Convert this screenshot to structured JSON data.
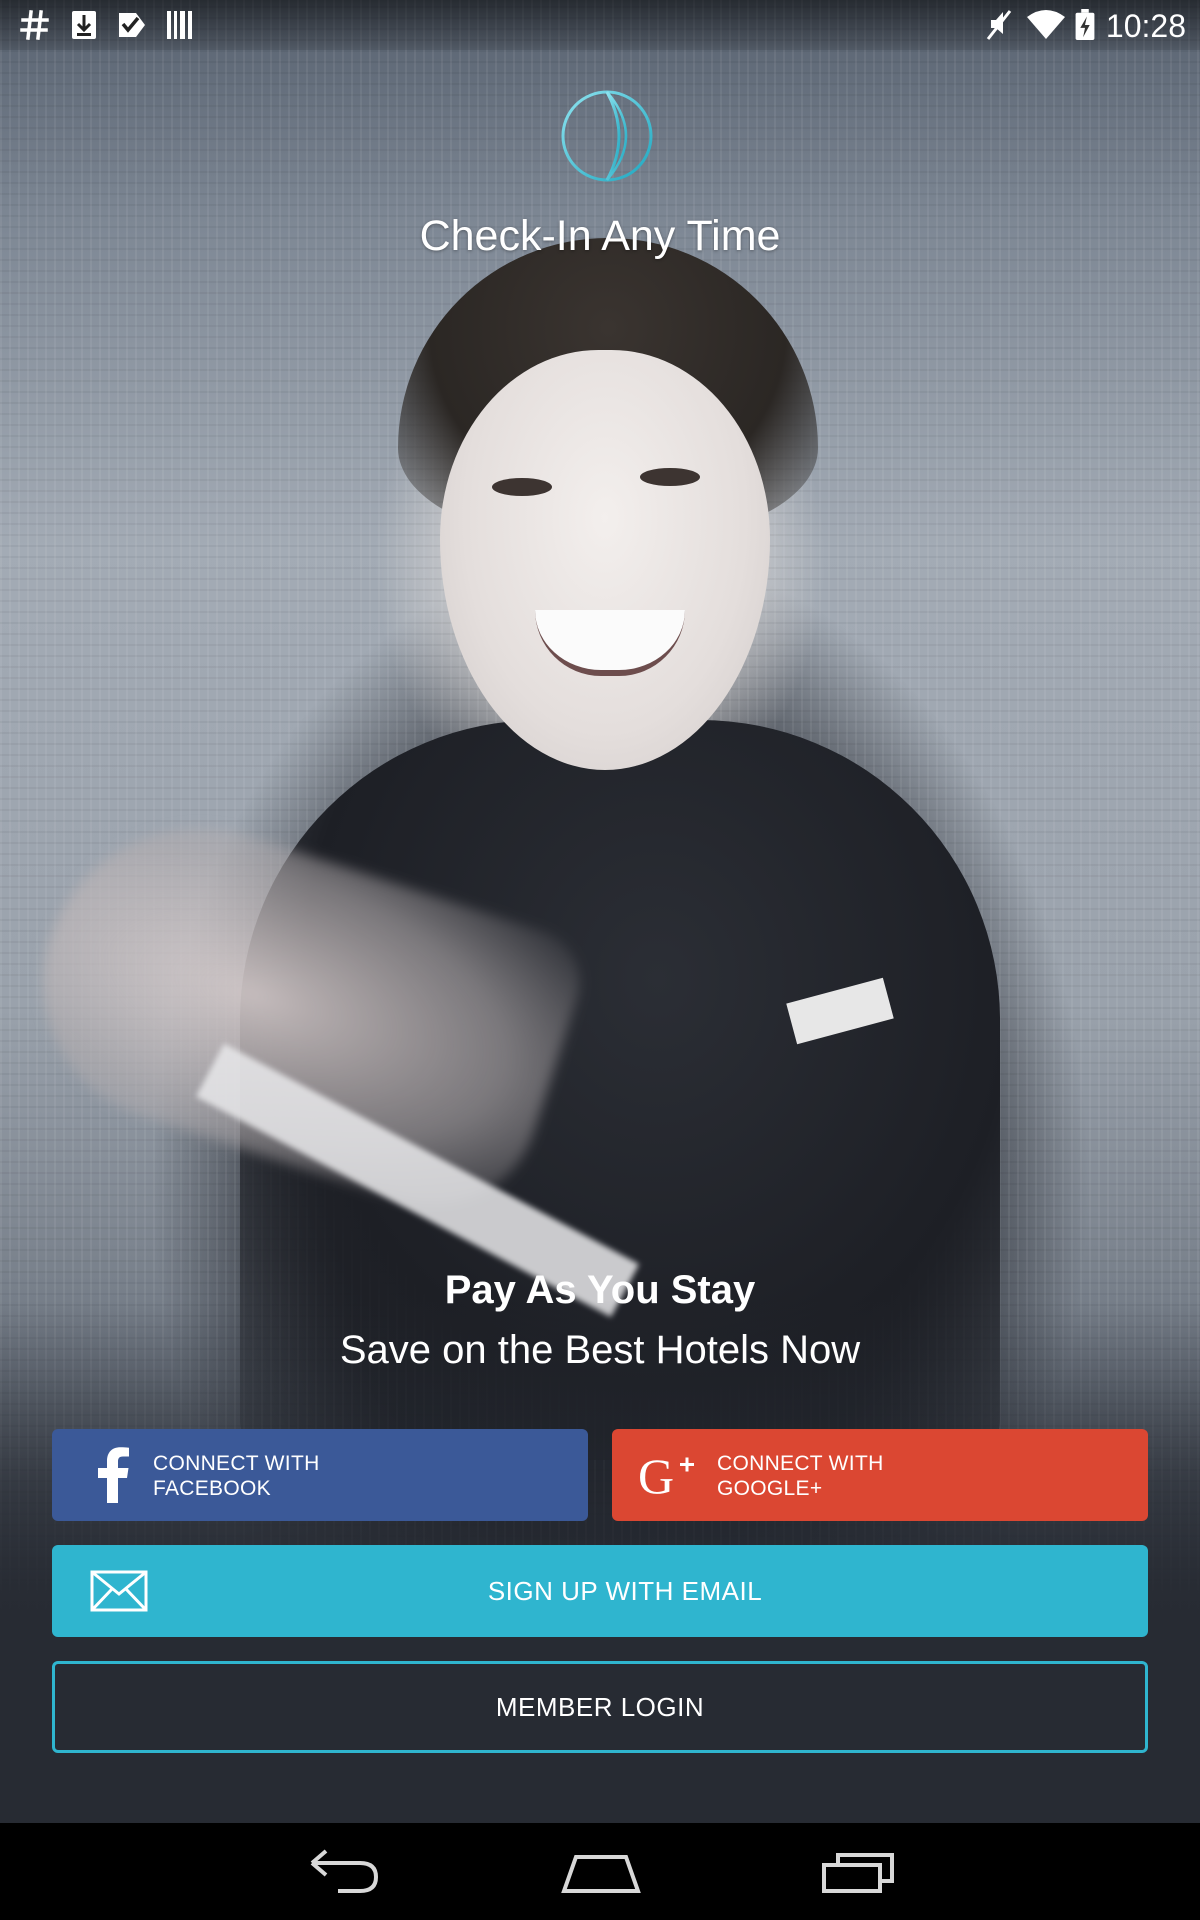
{
  "status_bar": {
    "time": "10:28",
    "left_icons": [
      "hash-icon",
      "download-icon",
      "checklist-icon",
      "barcode-icon"
    ],
    "right_icons": [
      "muted-icon",
      "wifi-icon",
      "battery-charging-icon"
    ]
  },
  "header": {
    "logo_icon": "globe-logo-icon",
    "tagline": "Check-In Any Time"
  },
  "promo": {
    "title": "Pay As You Stay",
    "subtitle": "Save on the Best Hotels Now"
  },
  "buttons": {
    "facebook": {
      "line1": "CONNECT WITH",
      "line2": "FACEBOOK",
      "icon": "facebook-icon",
      "color": "#3b5998"
    },
    "google": {
      "line1": "CONNECT WITH",
      "line2": "GOOGLE+",
      "icon": "google-plus-icon",
      "color": "#db4732"
    },
    "email": {
      "label": "SIGN UP WITH EMAIL",
      "icon": "envelope-icon",
      "color": "#2fb5cf"
    },
    "login": {
      "label": "MEMBER LOGIN",
      "border_color": "#2fb5cf"
    }
  },
  "nav_bar": {
    "icons": [
      "back-icon",
      "home-icon",
      "recent-apps-icon"
    ]
  }
}
